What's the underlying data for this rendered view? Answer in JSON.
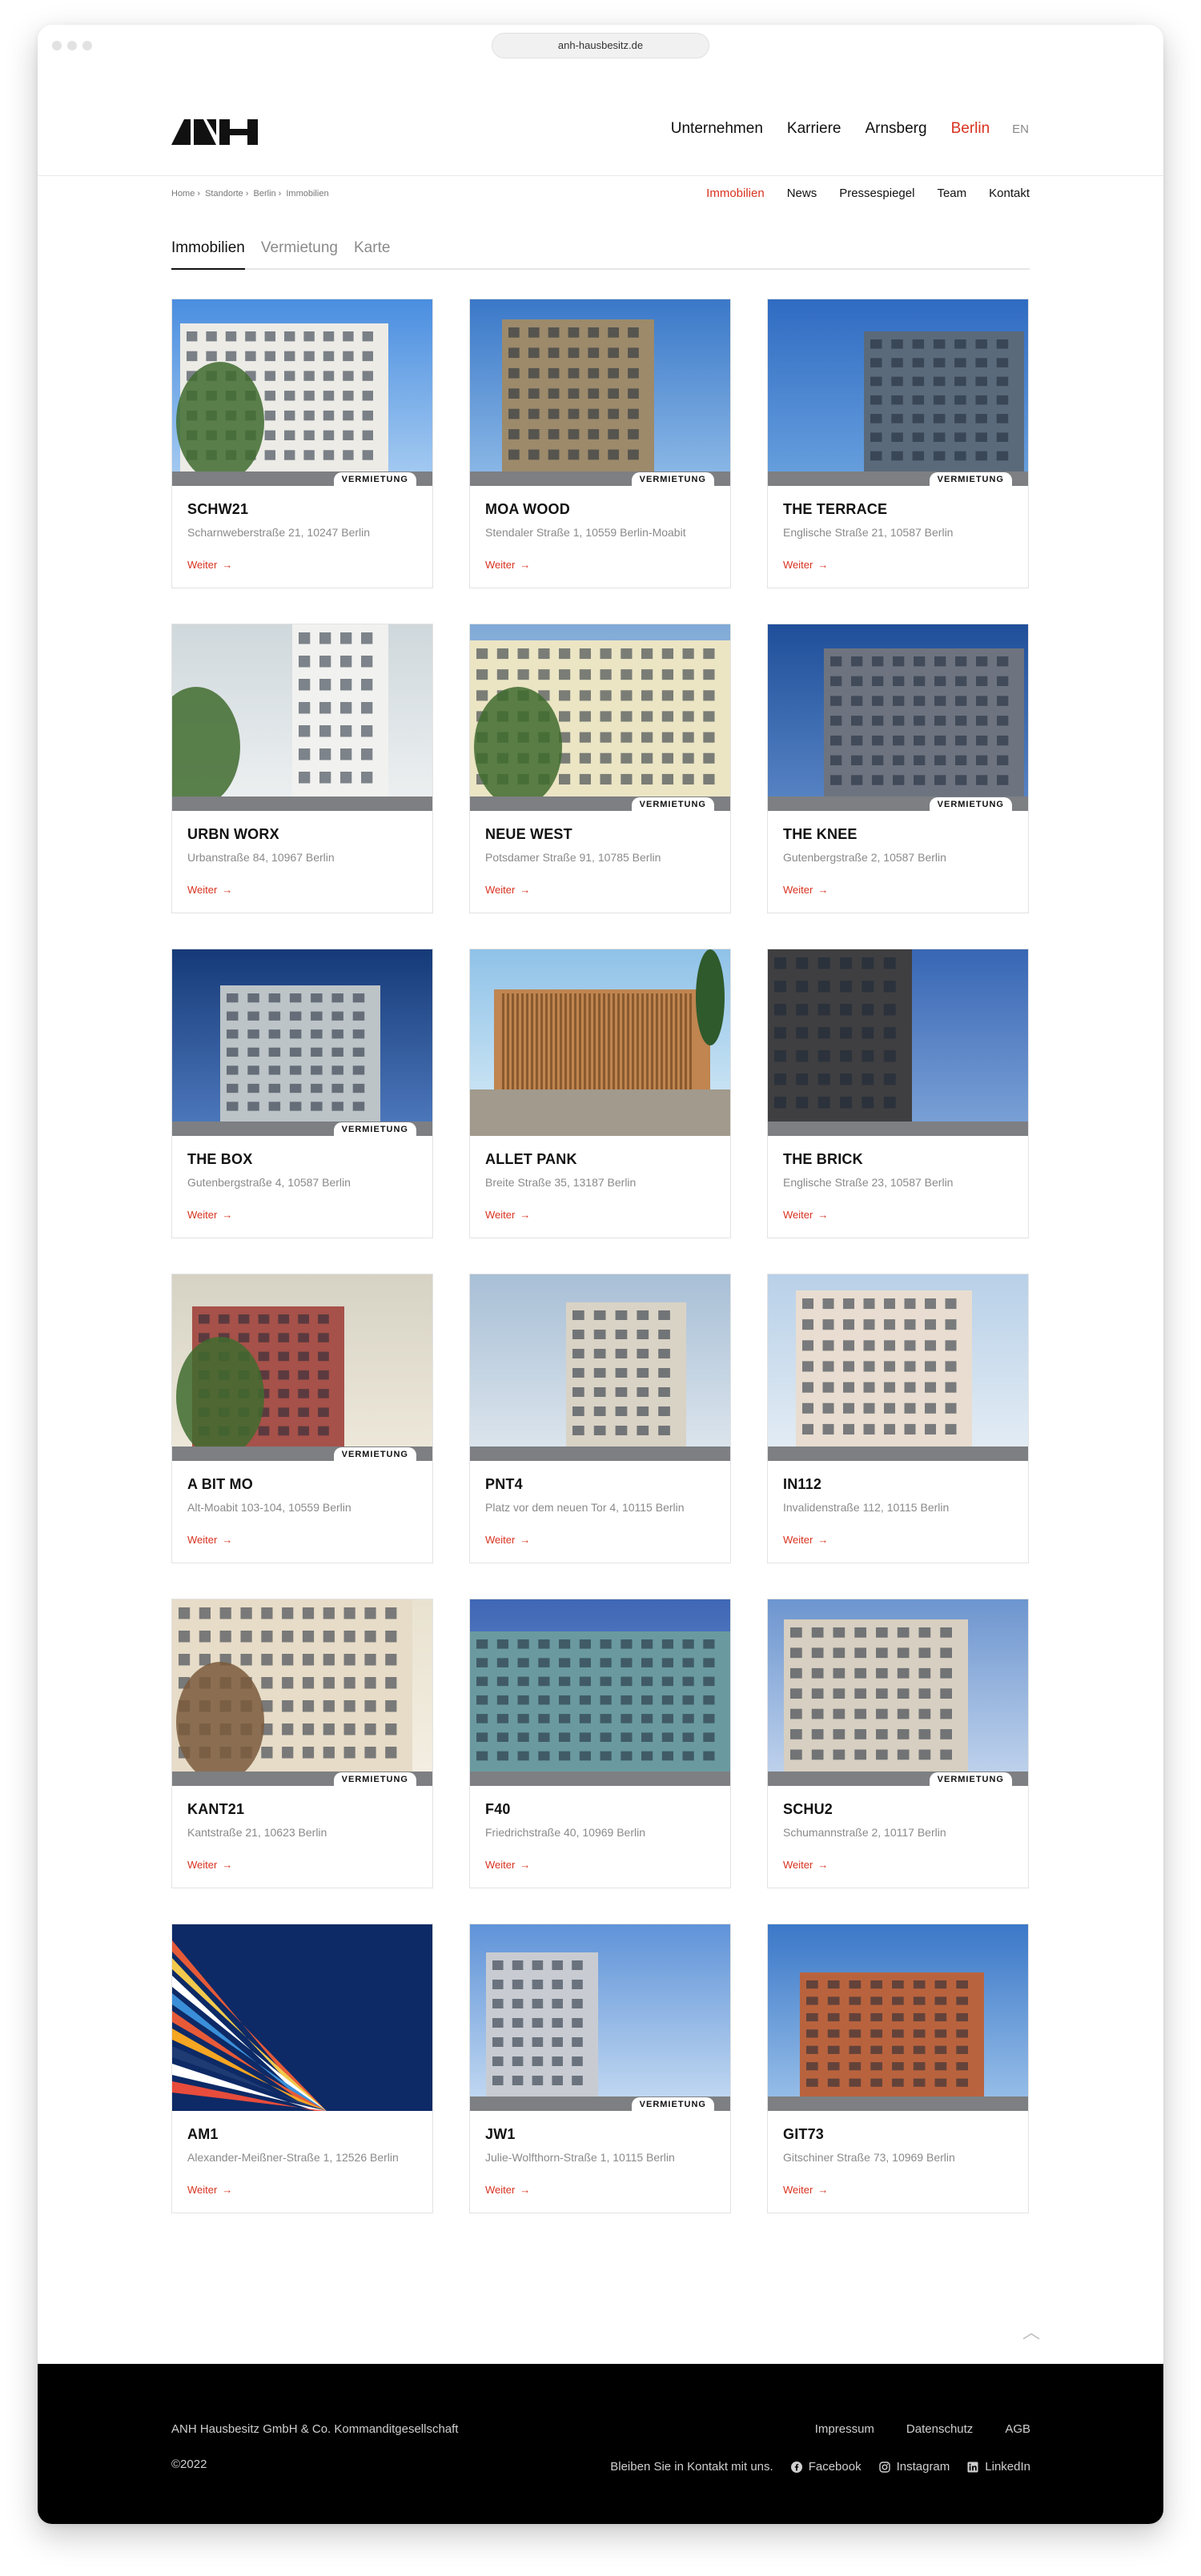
{
  "browser": {
    "url": "anh-hausbesitz.de"
  },
  "header": {
    "logo_text": "ANH",
    "nav": [
      "Unternehmen",
      "Karriere",
      "Arnsberg",
      "Berlin"
    ],
    "active_nav": "Berlin",
    "lang": "EN"
  },
  "breadcrumb": [
    "Home",
    "Standorte",
    "Berlin",
    "Immobilien"
  ],
  "subnav": [
    "Immobilien",
    "News",
    "Pressespiegel",
    "Team",
    "Kontakt"
  ],
  "tabs": [
    "Immobilien",
    "Vermietung",
    "Karte"
  ],
  "more_label": "Weiter",
  "properties": [
    {
      "name": "SCHW21",
      "address": "Scharnweberstraße 21, 10247 Berlin",
      "badge": "VERMIETUNG"
    },
    {
      "name": "MOA WOOD",
      "address": "Stendaler Straße 1, 10559 Berlin-Moabit",
      "badge": "VERMIETUNG"
    },
    {
      "name": "THE TERRACE",
      "address": "Englische Straße 21, 10587 Berlin",
      "badge": "VERMIETUNG"
    },
    {
      "name": "URBN WORX",
      "address": "Urbanstraße 84, 10967 Berlin",
      "badge": ""
    },
    {
      "name": "NEUE WEST",
      "address": "Potsdamer Straße 91, 10785 Berlin",
      "badge": "VERMIETUNG"
    },
    {
      "name": "THE KNEE",
      "address": "Gutenbergstraße 2, 10587 Berlin",
      "badge": "VERMIETUNG"
    },
    {
      "name": "THE BOX",
      "address": "Gutenbergstraße 4, 10587 Berlin",
      "badge": "VERMIETUNG"
    },
    {
      "name": "ALLET PANK",
      "address": "Breite Straße 35, 13187 Berlin",
      "badge": ""
    },
    {
      "name": "THE BRICK",
      "address": "Englische Straße 23, 10587 Berlin",
      "badge": ""
    },
    {
      "name": "A BIT MO",
      "address": "Alt-Moabit 103-104, 10559 Berlin",
      "badge": "VERMIETUNG"
    },
    {
      "name": "PNT4",
      "address": "Platz vor dem neuen Tor 4, 10115 Berlin",
      "badge": ""
    },
    {
      "name": "IN112",
      "address": "Invalidenstraße 112, 10115 Berlin",
      "badge": ""
    },
    {
      "name": "KANT21",
      "address": "Kantstraße 21, 10623 Berlin",
      "badge": "VERMIETUNG"
    },
    {
      "name": "F40",
      "address": "Friedrichstraße 40, 10969 Berlin",
      "badge": ""
    },
    {
      "name": "SCHU2",
      "address": "Schumannstraße 2, 10117 Berlin",
      "badge": "VERMIETUNG"
    },
    {
      "name": "AM1",
      "address": "Alexander-Meißner-Straße 1, 12526 Berlin",
      "badge": ""
    },
    {
      "name": "JW1",
      "address": "Julie-Wolfthorn-Straße 1, 10115 Berlin",
      "badge": "VERMIETUNG"
    },
    {
      "name": "GIT73",
      "address": "Gitschiner Straße 73, 10969 Berlin",
      "badge": ""
    }
  ],
  "footer": {
    "company": "ANH Hausbesitz GmbH & Co. Kommanditgesellschaft",
    "copyright": "©2022",
    "legal": [
      "Impressum",
      "Datenschutz",
      "AGB"
    ],
    "contact_text": "Bleiben Sie in Kontakt mit uns.",
    "social": [
      "Facebook",
      "Instagram",
      "LinkedIn"
    ]
  },
  "colors": {
    "accent": "#d8321f",
    "footer_bg": "#000000",
    "muted": "#8a8a8a"
  }
}
